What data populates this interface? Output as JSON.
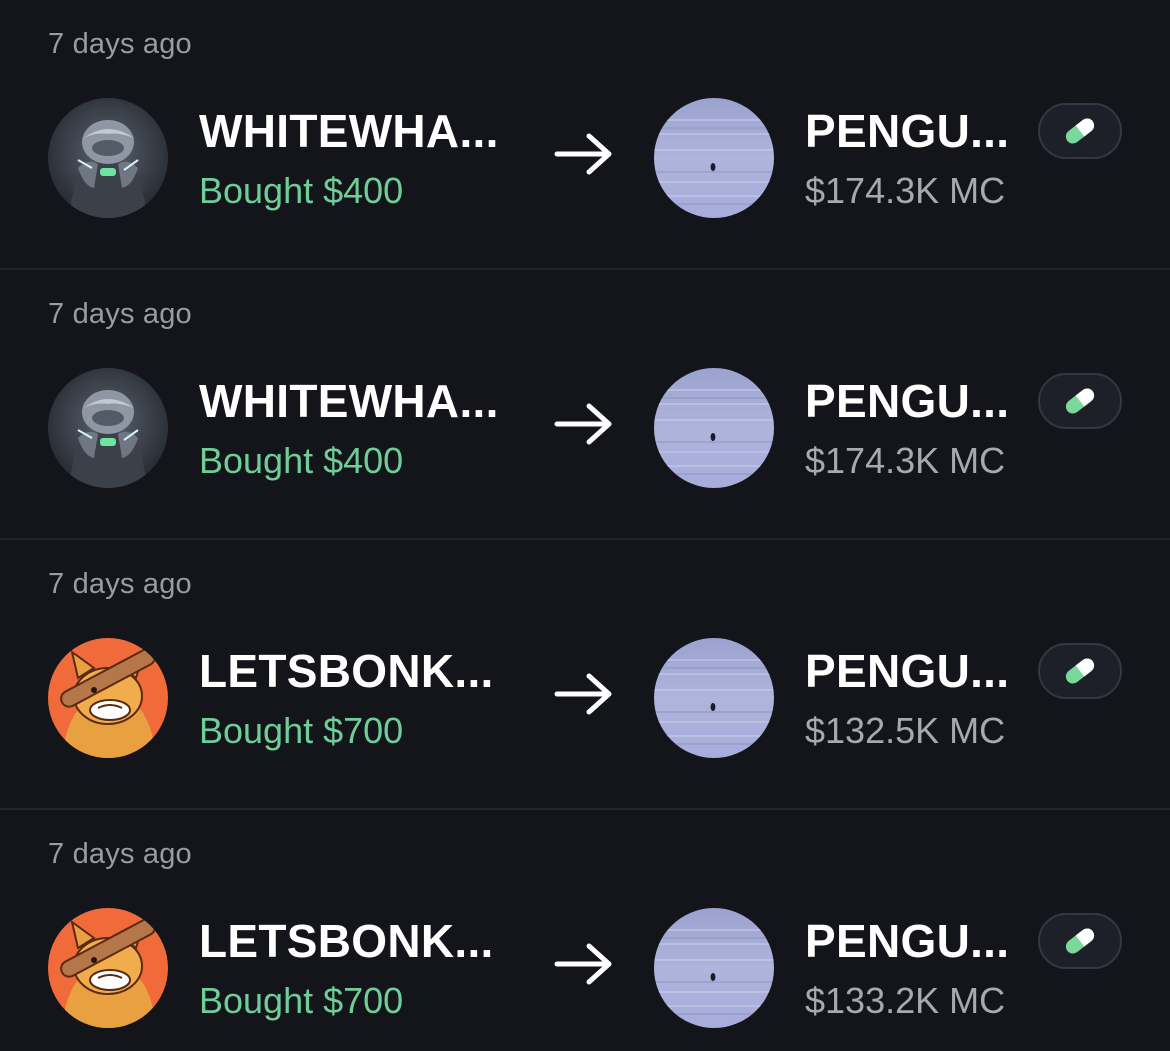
{
  "trades": [
    {
      "time": "7 days ago",
      "trader": {
        "name": "WHITEWHA...",
        "avatar_icon": "armored-whale-avatar-icon"
      },
      "action": "Bought $400",
      "token": {
        "name": "PENGU...",
        "market_cap": "$174.3K MC",
        "image_icon": "snowfield-penguin-token-icon"
      },
      "badge_icon": "pill-icon"
    },
    {
      "time": "7 days ago",
      "trader": {
        "name": "WHITEWHA...",
        "avatar_icon": "armored-whale-avatar-icon"
      },
      "action": "Bought $400",
      "token": {
        "name": "PENGU...",
        "market_cap": "$174.3K MC",
        "image_icon": "snowfield-penguin-token-icon"
      },
      "badge_icon": "pill-icon"
    },
    {
      "time": "7 days ago",
      "trader": {
        "name": "LETSBONK...",
        "avatar_icon": "bonk-dog-avatar-icon"
      },
      "action": "Bought $700",
      "token": {
        "name": "PENGU...",
        "market_cap": "$132.5K MC",
        "image_icon": "snowfield-penguin-token-icon"
      },
      "badge_icon": "pill-icon"
    },
    {
      "time": "7 days ago",
      "trader": {
        "name": "LETSBONK...",
        "avatar_icon": "bonk-dog-avatar-icon"
      },
      "action": "Bought $700",
      "token": {
        "name": "PENGU...",
        "market_cap": "$133.2K MC",
        "image_icon": "snowfield-penguin-token-icon"
      },
      "badge_icon": "pill-icon"
    }
  ],
  "colors": {
    "background": "#14151b",
    "divider": "#23252e",
    "bought_green": "#6fce98",
    "muted_text": "#9a9ba3",
    "pill_green": "#7ad99a"
  }
}
